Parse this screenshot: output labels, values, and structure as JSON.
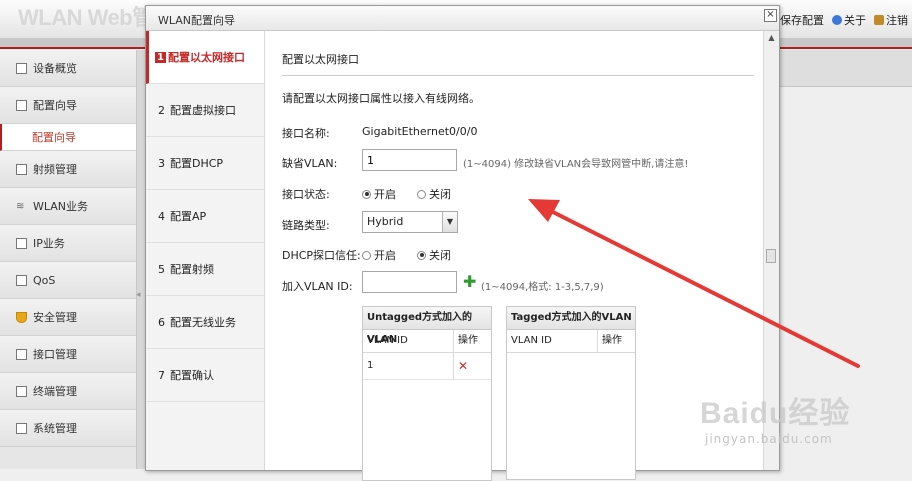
{
  "app": {
    "logo": "WLAN Web管",
    "header_links": [
      {
        "label": "保存配置",
        "icon": "save-icon",
        "color": "#4a7fc1"
      },
      {
        "label": "关于",
        "icon": "info-icon",
        "color": "#3b78d8"
      },
      {
        "label": "注销",
        "icon": "logout-icon",
        "color": "#c08a2a"
      }
    ]
  },
  "sidebar": {
    "items": [
      {
        "label": "设备概览",
        "icon": "overview-icon"
      },
      {
        "label": "配置向导",
        "icon": "wizard-icon"
      },
      {
        "label": "配置向导",
        "icon": "",
        "sub": true
      },
      {
        "label": "射频管理",
        "icon": "radio-icon"
      },
      {
        "label": "WLAN业务",
        "icon": "wifi-icon"
      },
      {
        "label": "IP业务",
        "icon": "ip-icon"
      },
      {
        "label": "QoS",
        "icon": "qos-icon"
      },
      {
        "label": "安全管理",
        "icon": "shield-icon"
      },
      {
        "label": "接口管理",
        "icon": "interface-icon"
      },
      {
        "label": "终端管理",
        "icon": "terminal-icon"
      },
      {
        "label": "系统管理",
        "icon": "system-icon"
      }
    ]
  },
  "dialog": {
    "title": "WLAN配置向导",
    "close": "×",
    "steps": [
      {
        "num": "1",
        "label": "配置以太网接口",
        "active": true
      },
      {
        "num": "2",
        "label": "配置虚拟接口",
        "active": false
      },
      {
        "num": "3",
        "label": "配置DHCP",
        "active": false
      },
      {
        "num": "4",
        "label": "配置AP",
        "active": false
      },
      {
        "num": "5",
        "label": "配置射频",
        "active": false
      },
      {
        "num": "6",
        "label": "配置无线业务",
        "active": false
      },
      {
        "num": "7",
        "label": "配置确认",
        "active": false
      }
    ],
    "content": {
      "title": "配置以太网接口",
      "intro": "请配置以太网接口属性以接入有线网络。",
      "iface_label": "接口名称:",
      "iface_value": "GigabitEthernet0/0/0",
      "vlan_label": "缺省VLAN:",
      "vlan_value": "1",
      "vlan_hint": "(1~4094) 修改缺省VLAN会导致网管中断,请注意!",
      "state_label": "接口状态:",
      "state_on": "开启",
      "state_off": "关闭",
      "link_label": "链路类型:",
      "link_value": "Hybrid",
      "dhcp_label": "DHCP探口信任:",
      "dhcp_on": "开启",
      "dhcp_off": "关闭",
      "join_label": "加入VLAN ID:",
      "join_value": "",
      "join_hint": "(1~4094,格式: 1-3,5,7,9)",
      "untagged": {
        "title": "Untagged方式加入的VLAN",
        "col1": "VLAN ID",
        "col2": "操作",
        "rows": [
          {
            "id": "1",
            "op": "✕"
          }
        ]
      },
      "tagged": {
        "title": "Tagged方式加入的VLAN",
        "col1": "VLAN ID",
        "col2": "操作"
      }
    }
  },
  "watermark": {
    "brand": "Baidu经验",
    "url": "jingyan.baidu.com"
  }
}
